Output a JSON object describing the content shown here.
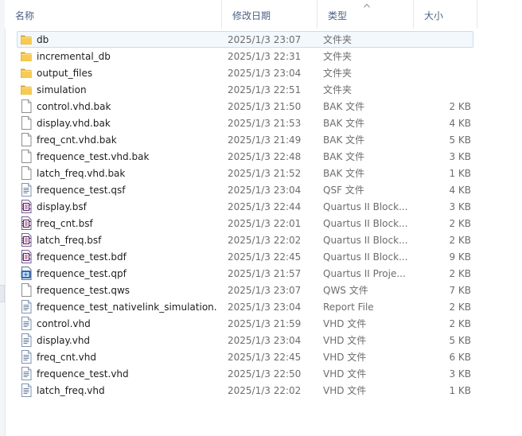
{
  "columns": {
    "name": "名称",
    "modified": "修改日期",
    "type": "类型",
    "size": "大小"
  },
  "files": [
    {
      "name": "db",
      "date": "2025/1/3 23:07",
      "type": "文件夹",
      "size": "",
      "icon": "folder-icon",
      "selected": true
    },
    {
      "name": "incremental_db",
      "date": "2025/1/3 22:31",
      "type": "文件夹",
      "size": "",
      "icon": "folder-icon"
    },
    {
      "name": "output_files",
      "date": "2025/1/3 23:04",
      "type": "文件夹",
      "size": "",
      "icon": "folder-icon"
    },
    {
      "name": "simulation",
      "date": "2025/1/3 22:51",
      "type": "文件夹",
      "size": "",
      "icon": "folder-icon"
    },
    {
      "name": "control.vhd.bak",
      "date": "2025/1/3 21:50",
      "type": "BAK 文件",
      "size": "2 KB",
      "icon": "blank-file-icon"
    },
    {
      "name": "display.vhd.bak",
      "date": "2025/1/3 21:53",
      "type": "BAK 文件",
      "size": "4 KB",
      "icon": "blank-file-icon"
    },
    {
      "name": "freq_cnt.vhd.bak",
      "date": "2025/1/3 21:49",
      "type": "BAK 文件",
      "size": "5 KB",
      "icon": "blank-file-icon"
    },
    {
      "name": "frequence_test.vhd.bak",
      "date": "2025/1/3 22:48",
      "type": "BAK 文件",
      "size": "3 KB",
      "icon": "blank-file-icon"
    },
    {
      "name": "latch_freq.vhd.bak",
      "date": "2025/1/3 21:52",
      "type": "BAK 文件",
      "size": "1 KB",
      "icon": "blank-file-icon"
    },
    {
      "name": "frequence_test.qsf",
      "date": "2025/1/3 23:04",
      "type": "QSF 文件",
      "size": "4 KB",
      "icon": "text-file-icon"
    },
    {
      "name": "display.bsf",
      "date": "2025/1/3 22:44",
      "type": "Quartus II Block...",
      "size": "3 KB",
      "icon": "quartus-block-icon"
    },
    {
      "name": "freq_cnt.bsf",
      "date": "2025/1/3 22:01",
      "type": "Quartus II Block...",
      "size": "2 KB",
      "icon": "quartus-block-icon"
    },
    {
      "name": "latch_freq.bsf",
      "date": "2025/1/3 22:02",
      "type": "Quartus II Block...",
      "size": "2 KB",
      "icon": "quartus-block-icon"
    },
    {
      "name": "frequence_test.bdf",
      "date": "2025/1/3 22:45",
      "type": "Quartus II Block...",
      "size": "9 KB",
      "icon": "quartus-block-icon"
    },
    {
      "name": "frequence_test.qpf",
      "date": "2025/1/3 21:57",
      "type": "Quartus II Proje...",
      "size": "2 KB",
      "icon": "quartus-project-icon"
    },
    {
      "name": "frequence_test.qws",
      "date": "2025/1/3 23:07",
      "type": "QWS 文件",
      "size": "7 KB",
      "icon": "blank-file-icon"
    },
    {
      "name": "frequence_test_nativelink_simulation.r...",
      "date": "2025/1/3 23:04",
      "type": "Report File",
      "size": "2 KB",
      "icon": "text-file-icon"
    },
    {
      "name": "control.vhd",
      "date": "2025/1/3 21:59",
      "type": "VHD 文件",
      "size": "2 KB",
      "icon": "text-file-icon"
    },
    {
      "name": "display.vhd",
      "date": "2025/1/3 23:04",
      "type": "VHD 文件",
      "size": "5 KB",
      "icon": "text-file-icon"
    },
    {
      "name": "freq_cnt.vhd",
      "date": "2025/1/3 22:45",
      "type": "VHD 文件",
      "size": "6 KB",
      "icon": "text-file-icon"
    },
    {
      "name": "frequence_test.vhd",
      "date": "2025/1/3 22:50",
      "type": "VHD 文件",
      "size": "3 KB",
      "icon": "text-file-icon"
    },
    {
      "name": "latch_freq.vhd",
      "date": "2025/1/3 22:02",
      "type": "VHD 文件",
      "size": "1 KB",
      "icon": "text-file-icon"
    }
  ]
}
